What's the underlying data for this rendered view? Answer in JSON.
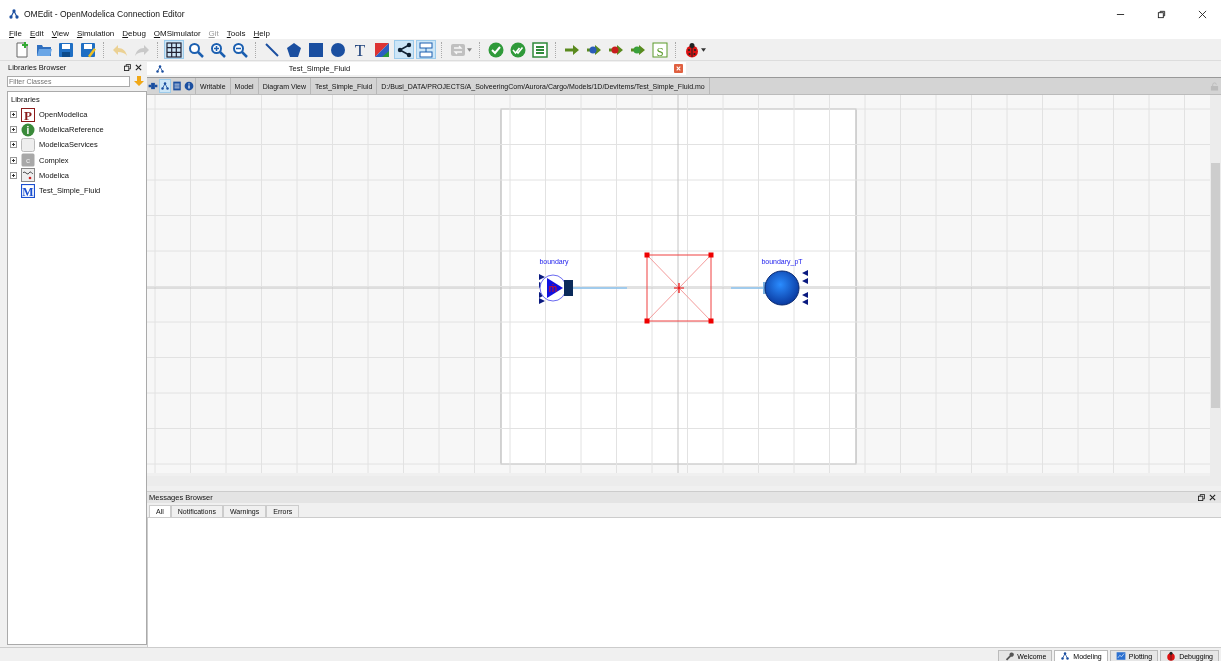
{
  "window": {
    "title": "OMEdit - OpenModelica Connection Editor"
  },
  "menu": [
    {
      "label": "File",
      "disabled": false
    },
    {
      "label": "Edit",
      "disabled": false
    },
    {
      "label": "View",
      "disabled": false
    },
    {
      "label": "Simulation",
      "disabled": false
    },
    {
      "label": "Debug",
      "disabled": false
    },
    {
      "label": "OMSimulator",
      "disabled": false
    },
    {
      "label": "Git",
      "disabled": true
    },
    {
      "label": "Tools",
      "disabled": false
    },
    {
      "label": "Help",
      "disabled": false
    }
  ],
  "toolbar": [
    {
      "kind": "new",
      "disabled": false
    },
    {
      "kind": "open",
      "disabled": false
    },
    {
      "kind": "save",
      "disabled": false
    },
    {
      "kind": "save-all",
      "disabled": false
    },
    {
      "kind": "separator"
    },
    {
      "kind": "undo",
      "disabled": true
    },
    {
      "kind": "redo",
      "disabled": true
    },
    {
      "kind": "separator"
    },
    {
      "kind": "grid",
      "selected": true,
      "disabled": false
    },
    {
      "kind": "zoom-fit",
      "disabled": false
    },
    {
      "kind": "zoom-in",
      "disabled": false
    },
    {
      "kind": "zoom-out",
      "disabled": false
    },
    {
      "kind": "separator"
    },
    {
      "kind": "line",
      "selected": false,
      "disabled": false
    },
    {
      "kind": "polygon",
      "selected": false,
      "disabled": false
    },
    {
      "kind": "rectangle",
      "selected": false,
      "disabled": false
    },
    {
      "kind": "ellipse",
      "selected": false,
      "disabled": false
    },
    {
      "kind": "text",
      "glyph": "T",
      "selected": false,
      "disabled": false
    },
    {
      "kind": "bitmap",
      "selected": false,
      "disabled": false
    },
    {
      "kind": "connect",
      "selected": true,
      "disabled": false
    },
    {
      "kind": "transition",
      "selected": true,
      "disabled": false
    },
    {
      "kind": "separator"
    },
    {
      "kind": "mode",
      "disabled": true,
      "dropdown": true
    },
    {
      "kind": "separator"
    },
    {
      "kind": "check",
      "disabled": false
    },
    {
      "kind": "check-all",
      "disabled": false
    },
    {
      "kind": "instantiate",
      "disabled": false
    },
    {
      "kind": "separator"
    },
    {
      "kind": "simulate",
      "disabled": false
    },
    {
      "kind": "simulate-blue",
      "disabled": false
    },
    {
      "kind": "simulate-red",
      "disabled": false
    },
    {
      "kind": "simulate-green",
      "disabled": false
    },
    {
      "kind": "sim-s",
      "glyph": "S",
      "disabled": false
    },
    {
      "kind": "separator"
    },
    {
      "kind": "debugger",
      "disabled": false,
      "dropdown": true
    }
  ],
  "libraries_browser": {
    "title": "Libraries Browser",
    "filter": {
      "placeholder": "Filter Classes"
    },
    "header": "Libraries",
    "items": [
      {
        "label": "OpenModelica",
        "kind": "package",
        "glyph": "P",
        "has_children": true
      },
      {
        "label": "ModelicaReference",
        "kind": "info",
        "glyph": "i",
        "has_children": true
      },
      {
        "label": "ModelicaServices",
        "kind": "blank",
        "has_children": true
      },
      {
        "label": "Complex",
        "kind": "grey",
        "glyph": "c",
        "has_children": true
      },
      {
        "label": "Modelica",
        "kind": "modelica",
        "has_children": true
      },
      {
        "label": "Test_Simple_Fluid",
        "kind": "model",
        "glyph": "M",
        "has_children": false
      }
    ]
  },
  "model_tab": {
    "title": "Test_Simple_Fluid"
  },
  "view_buttons": [
    {
      "kind": "icon-view",
      "selected": false
    },
    {
      "kind": "diagram-view",
      "selected": true
    },
    {
      "kind": "text-view",
      "selected": false
    },
    {
      "kind": "documentation-view",
      "selected": false
    }
  ],
  "info_bar": [
    "Writable",
    "Model",
    "Diagram View",
    "Test_Simple_Fluid",
    "D:/Busi_DATA/PROJECTS/A_SolveeringCom/Aurora/Cargo/Models/1D/DevItems/Test_Simple_Fluid.mo"
  ],
  "diagram": {
    "components": [
      {
        "kind": "mass-flow-source",
        "label": "boundary",
        "symbol": "ṁ",
        "selected": false
      },
      {
        "kind": "empty",
        "selected": true
      },
      {
        "kind": "pressure-source",
        "label": "boundary_pT",
        "selected": false
      }
    ]
  },
  "messages_browser": {
    "title": "Messages Browser",
    "tabs": [
      {
        "label": "All",
        "selected": true
      },
      {
        "label": "Notifications",
        "selected": false
      },
      {
        "label": "Warnings",
        "selected": false
      },
      {
        "label": "Errors",
        "selected": false
      }
    ]
  },
  "perspectives": [
    {
      "label": "Welcome",
      "kind": "welcome",
      "selected": false
    },
    {
      "label": "Modeling",
      "kind": "modeling",
      "selected": true
    },
    {
      "label": "Plotting",
      "kind": "plotting",
      "selected": false
    },
    {
      "label": "Debugging",
      "kind": "debugging",
      "selected": false
    }
  ]
}
